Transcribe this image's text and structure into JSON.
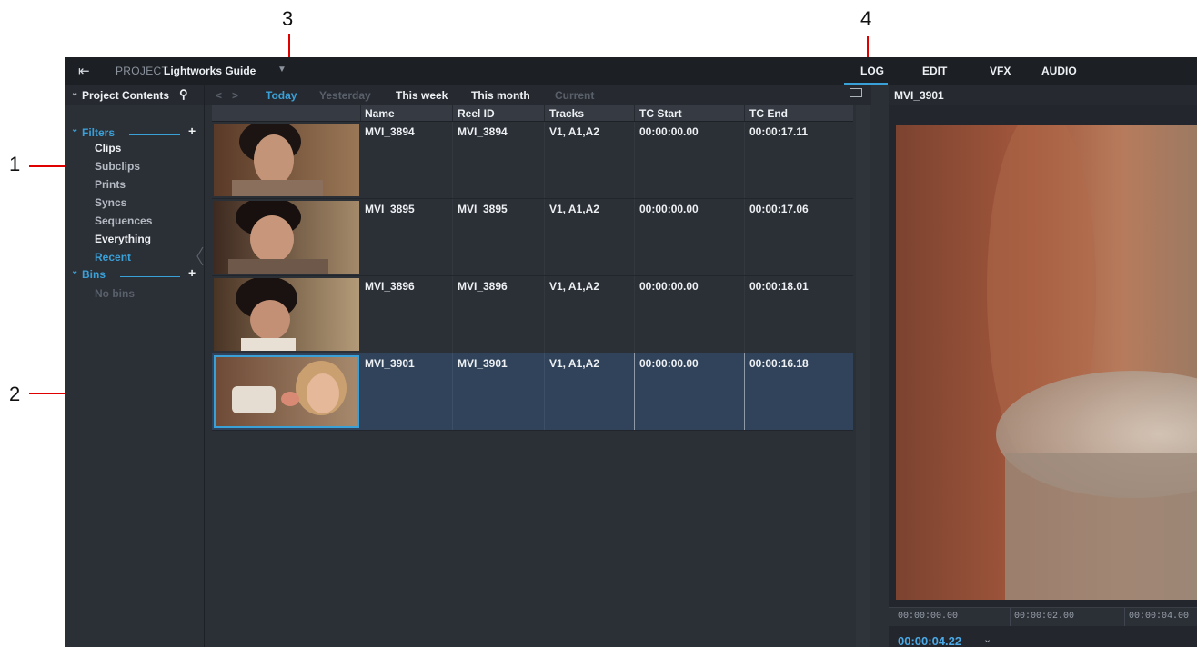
{
  "callouts": [
    "1",
    "2",
    "3",
    "4"
  ],
  "topbar": {
    "project_label": "PROJECT",
    "project_name": "Lightworks Guide",
    "tabs": [
      {
        "label": "LOG",
        "active": true
      },
      {
        "label": "EDIT",
        "active": false
      },
      {
        "label": "VFX",
        "active": false
      },
      {
        "label": "AUDIO",
        "active": false
      }
    ]
  },
  "left_panel": {
    "header": "Project Contents",
    "filters_title": "Filters",
    "filters": [
      {
        "label": "Clips",
        "state": "bright"
      },
      {
        "label": "Subclips",
        "state": "dim"
      },
      {
        "label": "Prints",
        "state": "dim"
      },
      {
        "label": "Syncs",
        "state": "dim"
      },
      {
        "label": "Sequences",
        "state": "dim"
      },
      {
        "label": "Everything",
        "state": "bright"
      },
      {
        "label": "Recent",
        "state": "active"
      }
    ],
    "bins_title": "Bins",
    "bins_empty": "No bins"
  },
  "filter_bar": [
    {
      "label": "Today",
      "state": "active"
    },
    {
      "label": "Yesterday",
      "state": "dim"
    },
    {
      "label": "This week",
      "state": "bright"
    },
    {
      "label": "This month",
      "state": "bright"
    },
    {
      "label": "Current",
      "state": "dim"
    }
  ],
  "table": {
    "columns": [
      "Name",
      "Reel ID",
      "Tracks",
      "TC Start",
      "TC End"
    ],
    "rows": [
      {
        "name": "MVI_3894",
        "reel": "MVI_3894",
        "tracks": "V1, A1,A2",
        "tc_start": "00:00:00.00",
        "tc_end": "00:00:17.11",
        "selected": false
      },
      {
        "name": "MVI_3895",
        "reel": "MVI_3895",
        "tracks": "V1, A1,A2",
        "tc_start": "00:00:00.00",
        "tc_end": "00:00:17.06",
        "selected": false
      },
      {
        "name": "MVI_3896",
        "reel": "MVI_3896",
        "tracks": "V1, A1,A2",
        "tc_start": "00:00:00.00",
        "tc_end": "00:00:18.01",
        "selected": false
      },
      {
        "name": "MVI_3901",
        "reel": "MVI_3901",
        "tracks": "V1, A1,A2",
        "tc_start": "00:00:00.00",
        "tc_end": "00:00:16.18",
        "selected": true
      }
    ]
  },
  "viewer": {
    "title": "MVI_3901",
    "ruler": [
      "00:00:00.00",
      "00:00:02.00",
      "00:00:04.00"
    ],
    "timecode": "00:00:04.22"
  },
  "colors": {
    "accent": "#3aa0d8",
    "callout_line": "#e00000",
    "selected_row": "#31435a"
  }
}
